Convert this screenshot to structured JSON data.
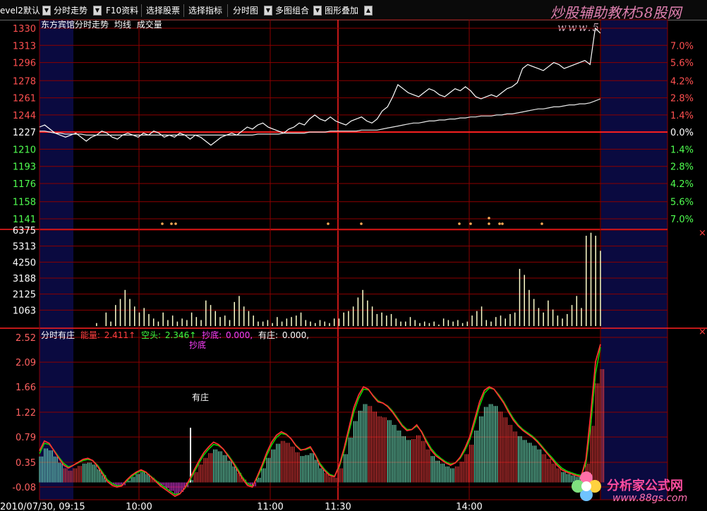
{
  "toolbar": {
    "items": [
      {
        "label": "evel2默认"
      },
      {
        "label": "分时走势"
      },
      {
        "label": "F10资料"
      },
      {
        "label": "选择股票"
      },
      {
        "label": "选择指标"
      },
      {
        "label": "分时图"
      },
      {
        "label": "多图组合"
      },
      {
        "label": "图形叠加"
      }
    ]
  },
  "watermarks": {
    "brand_top": "炒股辅助教材58股网",
    "url_top": "www.58Gu.com",
    "brand_bottom": "分析家公式网",
    "url_bottom": "www.88gs.com"
  },
  "colors": {
    "grid": "#8b0000",
    "price": "#ffffff",
    "avg": "#e8e8e8",
    "up": "#ff4040",
    "down": "#40ff40",
    "red_line": "#ff3030",
    "green_line": "#00dd00",
    "dots": "#ffaa55",
    "vol": "#ffffcc",
    "cyan": "#7fffd4",
    "magenta": "#ff40ff"
  },
  "chart_data": [
    {
      "type": "line",
      "title": "东方宾馆分时走势",
      "legend": [
        "均线",
        "成交量"
      ],
      "y_ticks": [
        "1330",
        "1313",
        "1296",
        "1278",
        "1261",
        "1244",
        "1227",
        "1210",
        "1193",
        "1176",
        "1158",
        "1141"
      ],
      "pct_ticks": [
        "7.0%",
        "5.6%",
        "4.2%",
        "2.8%",
        "1.4%",
        "0.0%",
        "1.4%",
        "2.8%",
        "4.2%",
        "5.6%",
        "7.0%"
      ],
      "ylim": [
        1141,
        1330
      ],
      "base": 1227,
      "x_ticks": [
        "2010/07/30, 09:15",
        "10:00",
        "11:00",
        "11:30",
        "14:00"
      ],
      "series": [
        {
          "name": "分时走势",
          "values": [
            1232,
            1234,
            1230,
            1226,
            1224,
            1222,
            1224,
            1226,
            1222,
            1218,
            1222,
            1224,
            1228,
            1226,
            1222,
            1220,
            1224,
            1226,
            1224,
            1222,
            1226,
            1224,
            1228,
            1226,
            1222,
            1224,
            1222,
            1226,
            1224,
            1220,
            1224,
            1222,
            1218,
            1214,
            1218,
            1222,
            1224,
            1226,
            1224,
            1228,
            1232,
            1230,
            1234,
            1236,
            1232,
            1230,
            1228,
            1226,
            1230,
            1232,
            1236,
            1234,
            1240,
            1244,
            1240,
            1238,
            1242,
            1238,
            1236,
            1234,
            1238,
            1240,
            1242,
            1238,
            1236,
            1240,
            1248,
            1252,
            1262,
            1274,
            1270,
            1266,
            1264,
            1262,
            1266,
            1270,
            1268,
            1264,
            1262,
            1266,
            1270,
            1268,
            1272,
            1268,
            1262,
            1260,
            1262,
            1264,
            1262,
            1266,
            1270,
            1272,
            1276,
            1290,
            1294,
            1292,
            1290,
            1288,
            1292,
            1296,
            1294,
            1290,
            1292,
            1294,
            1296,
            1298,
            1294,
            1330,
            1325
          ]
        },
        {
          "name": "均线",
          "values": [
            1228,
            1228,
            1227,
            1226,
            1226,
            1225,
            1225,
            1225,
            1225,
            1224,
            1224,
            1224,
            1224,
            1224,
            1224,
            1224,
            1224,
            1224,
            1224,
            1224,
            1224,
            1224,
            1224,
            1224,
            1224,
            1224,
            1224,
            1224,
            1224,
            1224,
            1224,
            1224,
            1224,
            1224,
            1224,
            1224,
            1224,
            1224,
            1224,
            1224,
            1224,
            1224,
            1225,
            1225,
            1225,
            1225,
            1225,
            1226,
            1226,
            1226,
            1226,
            1226,
            1227,
            1227,
            1227,
            1227,
            1228,
            1228,
            1228,
            1228,
            1228,
            1228,
            1229,
            1229,
            1229,
            1229,
            1230,
            1231,
            1232,
            1233,
            1234,
            1235,
            1236,
            1236,
            1237,
            1238,
            1238,
            1239,
            1239,
            1240,
            1240,
            1241,
            1241,
            1242,
            1242,
            1243,
            1243,
            1243,
            1244,
            1244,
            1245,
            1245,
            1246,
            1247,
            1248,
            1249,
            1250,
            1250,
            1251,
            1252,
            1252,
            1253,
            1254,
            1254,
            1255,
            1255,
            1256,
            1258,
            1260
          ]
        }
      ]
    },
    {
      "type": "bar",
      "title": "成交量",
      "y_ticks": [
        "6375",
        "5313",
        "4250",
        "3188",
        "2125",
        "1063"
      ],
      "ylim": [
        0,
        6375
      ],
      "values": [
        0,
        0,
        0,
        0,
        0,
        0,
        0,
        0,
        0,
        0,
        0,
        0,
        200,
        0,
        900,
        300,
        1400,
        1800,
        2400,
        1800,
        1300,
        900,
        1200,
        800,
        500,
        300,
        900,
        400,
        700,
        300,
        500,
        400,
        900,
        600,
        400,
        1700,
        1400,
        1000,
        600,
        700,
        400,
        1600,
        2000,
        1300,
        1000,
        700,
        300,
        300,
        400,
        200,
        600,
        300,
        500,
        600,
        700,
        900,
        400,
        300,
        200,
        400,
        300,
        200,
        500,
        500,
        900,
        1000,
        1300,
        1900,
        2400,
        1700,
        1300,
        800,
        900,
        700,
        800,
        500,
        300,
        300,
        600,
        400,
        200,
        300,
        200,
        300,
        100,
        500,
        400,
        300,
        400,
        200,
        300,
        700,
        1000,
        1300,
        400,
        300,
        600,
        700,
        500,
        800,
        900,
        3800,
        3400,
        2400,
        1800,
        1200,
        900,
        1700,
        1100,
        700,
        500,
        800,
        1400,
        2000,
        1200,
        6000,
        6200,
        6000,
        5000
      ],
      "extra": [
        0,
        0,
        0,
        0,
        0,
        0,
        0,
        0,
        0,
        0,
        0,
        0,
        0,
        0,
        0,
        0,
        0,
        0,
        0,
        0,
        0,
        0,
        0,
        0,
        0,
        0,
        0,
        0,
        0,
        0,
        0,
        0,
        0,
        0,
        0,
        0,
        0,
        0,
        0,
        0,
        0,
        0,
        0,
        0,
        0,
        0,
        0,
        0,
        0,
        0,
        0,
        0,
        0,
        0,
        0,
        0,
        0,
        0,
        0,
        0,
        0,
        0,
        0,
        0,
        0,
        0,
        0,
        0,
        0,
        0,
        0,
        0,
        0,
        0,
        0,
        0,
        0,
        0,
        0,
        0,
        0,
        0,
        0,
        0,
        0,
        0,
        0,
        0,
        0,
        0,
        0,
        0,
        0,
        0,
        0,
        0,
        0,
        0,
        0,
        0,
        0,
        0,
        0,
        0,
        0,
        0,
        0,
        0,
        0,
        0,
        0,
        0,
        0,
        0,
        0,
        0,
        0,
        0,
        0,
        0,
        0,
        0
      ]
    },
    {
      "type": "line",
      "title": "分时有庄",
      "legend": [
        {
          "label": "能量:",
          "value": "2.411↑"
        },
        {
          "label": "空头:",
          "value": "2.346↑"
        },
        {
          "label": "抄底:",
          "value": "0.000,"
        },
        {
          "label": "有庄:",
          "value": "0.000,"
        }
      ],
      "marker_label": "抄底",
      "annotation": "有庄",
      "y_ticks": [
        "2.52",
        "2.09",
        "1.66",
        "1.22",
        "0.79",
        "0.35",
        "-0.08"
      ],
      "ylim": [
        -0.3,
        2.52
      ],
      "series": [
        {
          "name": "能量",
          "values": [
            0.55,
            0.72,
            0.68,
            0.55,
            0.42,
            0.3,
            0.25,
            0.3,
            0.35,
            0.4,
            0.42,
            0.38,
            0.28,
            0.15,
            0.02,
            -0.05,
            -0.08,
            -0.06,
            0.04,
            0.12,
            0.18,
            0.22,
            0.18,
            0.1,
            0.02,
            -0.06,
            -0.12,
            -0.18,
            -0.24,
            -0.2,
            -0.1,
            0.05,
            0.22,
            0.38,
            0.52,
            0.62,
            0.7,
            0.66,
            0.58,
            0.46,
            0.34,
            0.2,
            0.06,
            -0.05,
            -0.08,
            0.1,
            0.3,
            0.52,
            0.7,
            0.82,
            0.88,
            0.84,
            0.76,
            0.64,
            0.56,
            0.58,
            0.62,
            0.48,
            0.3,
            0.2,
            0.12,
            0.1,
            0.3,
            0.6,
            0.95,
            1.3,
            1.52,
            1.66,
            1.62,
            1.5,
            1.4,
            1.38,
            1.32,
            1.22,
            1.1,
            0.98,
            0.9,
            0.92,
            1.0,
            0.88,
            0.7,
            0.56,
            0.46,
            0.4,
            0.34,
            0.3,
            0.34,
            0.44,
            0.6,
            0.8,
            1.1,
            1.4,
            1.6,
            1.66,
            1.62,
            1.5,
            1.38,
            1.22,
            1.08,
            0.98,
            0.9,
            0.84,
            0.78,
            0.7,
            0.6,
            0.5,
            0.4,
            0.3,
            0.22,
            0.18,
            0.15,
            0.12,
            0.1,
            0.4,
            1.2,
            2.1,
            2.4
          ]
        },
        {
          "name": "空头",
          "values": [
            0.5,
            0.68,
            0.66,
            0.56,
            0.44,
            0.33,
            0.27,
            0.3,
            0.34,
            0.38,
            0.4,
            0.38,
            0.3,
            0.18,
            0.05,
            -0.02,
            -0.06,
            -0.05,
            0.02,
            0.1,
            0.16,
            0.2,
            0.17,
            0.11,
            0.04,
            -0.03,
            -0.09,
            -0.15,
            -0.21,
            -0.19,
            -0.11,
            0.02,
            0.18,
            0.34,
            0.48,
            0.58,
            0.66,
            0.64,
            0.58,
            0.48,
            0.36,
            0.23,
            0.09,
            -0.02,
            -0.06,
            0.07,
            0.26,
            0.47,
            0.65,
            0.78,
            0.85,
            0.83,
            0.76,
            0.65,
            0.57,
            0.57,
            0.6,
            0.49,
            0.33,
            0.22,
            0.14,
            0.11,
            0.27,
            0.55,
            0.88,
            1.22,
            1.46,
            1.62,
            1.61,
            1.51,
            1.42,
            1.38,
            1.33,
            1.24,
            1.12,
            1.0,
            0.92,
            0.92,
            0.98,
            0.89,
            0.73,
            0.59,
            0.49,
            0.42,
            0.36,
            0.32,
            0.34,
            0.42,
            0.56,
            0.75,
            1.03,
            1.33,
            1.55,
            1.64,
            1.62,
            1.52,
            1.4,
            1.25,
            1.11,
            1.0,
            0.92,
            0.86,
            0.8,
            0.72,
            0.62,
            0.52,
            0.43,
            0.33,
            0.25,
            0.2,
            0.17,
            0.14,
            0.12,
            0.32,
            1.0,
            1.9,
            2.35
          ]
        }
      ]
    }
  ]
}
